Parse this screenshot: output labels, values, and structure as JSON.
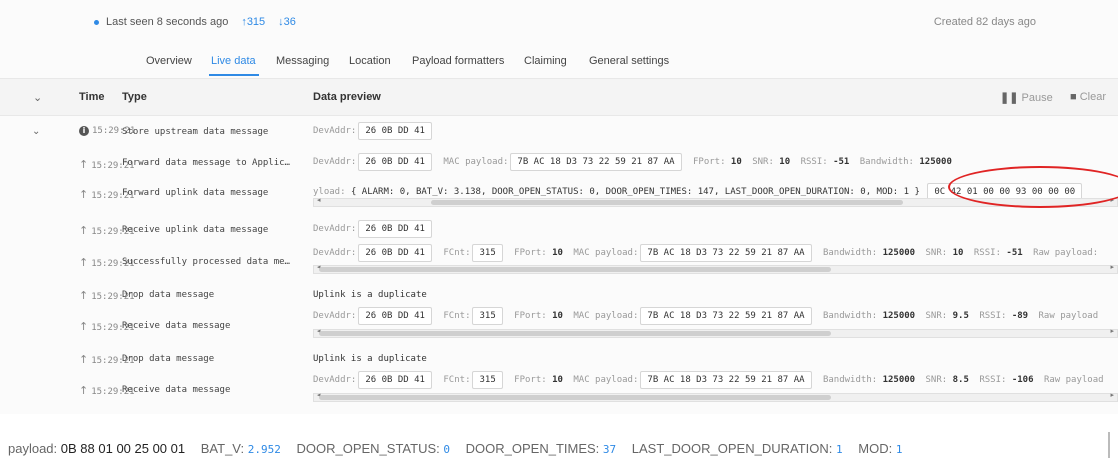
{
  "status": {
    "last_seen": "Last seen 8 seconds ago",
    "uplink_count": "315",
    "downlink_count": "36",
    "created": "Created 82 days ago"
  },
  "tabs": [
    {
      "label": "Overview"
    },
    {
      "label": "Live data"
    },
    {
      "label": "Messaging"
    },
    {
      "label": "Location"
    },
    {
      "label": "Payload formatters"
    },
    {
      "label": "Claiming"
    },
    {
      "label": "General settings"
    }
  ],
  "table": {
    "col_time": "Time",
    "col_type": "Type",
    "col_preview": "Data preview",
    "pause": "Pause",
    "clear": "Clear"
  },
  "labels": {
    "devaddr": "DevAddr:",
    "mac_payload": "MAC payload:",
    "fport": "FPort:",
    "fcnt": "FCnt:",
    "snr": "SNR:",
    "rssi": "RSSI:",
    "bandwidth": "Bandwidth:",
    "raw_payload": "Raw payload:",
    "raw_payload_short": "Raw payload",
    "payload_prefix": "yload:",
    "duplicate": "Uplink is a duplicate"
  },
  "rows": [
    {
      "time": "15:29:21",
      "type": "Store upstream data message",
      "devaddr": "26 0B DD 41"
    },
    {
      "time": "15:29:21",
      "type": "Forward data message to Applic…",
      "devaddr": "26 0B DD 41",
      "mac": "7B AC 18 D3 73 22 59 21 87 AA",
      "fport": "10",
      "snr": "10",
      "rssi": "-51",
      "bandwidth": "125000"
    },
    {
      "time": "15:29:21",
      "type": "Forward uplink data message",
      "decoded": "{ ALARM: 0, BAT_V: 3.138, DOOR_OPEN_STATUS: 0, DOOR_OPEN_TIMES: 147, LAST_DOOR_OPEN_DURATION: 0, MOD: 1 }",
      "raw": "0C 42 01 00 00 93 00 00 00"
    },
    {
      "time": "15:29:21",
      "type": "Receive uplink data message",
      "devaddr": "26 0B DD 41"
    },
    {
      "time": "15:29:21",
      "type": "Successfully processed data me…",
      "devaddr": "26 0B DD 41",
      "fcnt": "315",
      "fport": "10",
      "mac": "7B AC 18 D3 73 22 59 21 87 AA",
      "bandwidth": "125000",
      "snr": "10",
      "rssi": "-51"
    },
    {
      "time": "15:29:21",
      "type": "Drop data message"
    },
    {
      "time": "15:29:21",
      "type": "Receive data message",
      "devaddr": "26 0B DD 41",
      "fcnt": "315",
      "fport": "10",
      "mac": "7B AC 18 D3 73 22 59 21 87 AA",
      "bandwidth": "125000",
      "snr": "9.5",
      "rssi": "-89"
    },
    {
      "time": "15:29:21",
      "type": "Drop data message"
    },
    {
      "time": "15:29:21",
      "type": "Receive data message",
      "devaddr": "26 0B DD 41",
      "fcnt": "315",
      "fport": "10",
      "mac": "7B AC 18 D3 73 22 59 21 87 AA",
      "bandwidth": "125000",
      "snr": "8.5",
      "rssi": "-106"
    }
  ],
  "bottom": {
    "payload_key": "payload:",
    "payload_val": "0B 88 01 00 25 00 01",
    "bat_key": "BAT_V:",
    "bat_val": "2.952",
    "dos_key": "DOOR_OPEN_STATUS:",
    "dos_val": "0",
    "dot_key": "DOOR_OPEN_TIMES:",
    "dot_val": "37",
    "ldod_key": "LAST_DOOR_OPEN_DURATION:",
    "ldod_val": "1",
    "mod_key": "MOD:",
    "mod_val": "1"
  },
  "colors": {
    "accent": "#2f8ae5",
    "highlight": "#e02424",
    "value_green": "#3aa65b"
  }
}
